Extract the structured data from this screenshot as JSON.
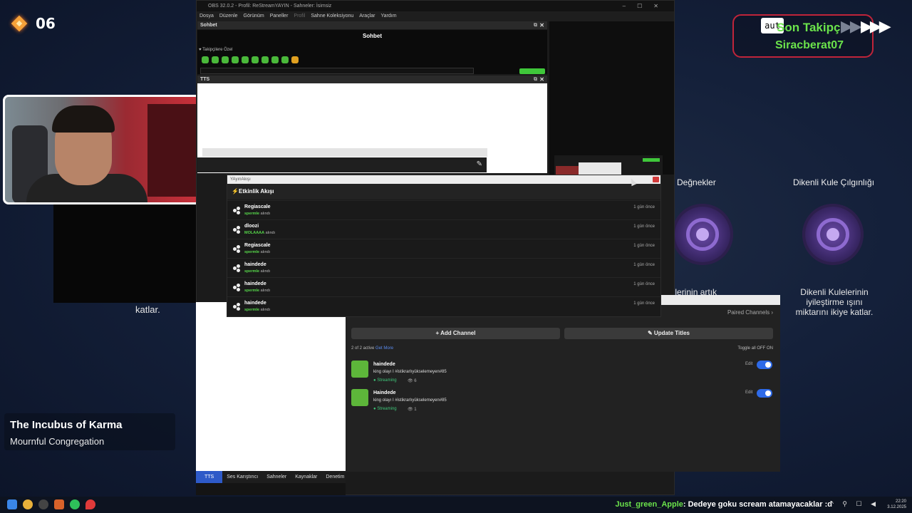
{
  "overlay": {
    "level": "06",
    "follower": {
      "logo": "aut",
      "title": "Son Takipçi",
      "name": "Siracberat07"
    },
    "cards": [
      {
        "title": "am Değnekler",
        "text": "ücülerinin artık"
      },
      {
        "title": "Dikenli Kule Çılgınlığı",
        "text": "Dikenli Kulelerinin iyileştirme ışını miktarını ikiye katlar."
      }
    ],
    "left_card_fragment": "katlar.",
    "song": {
      "title": "The Incubus of Karma",
      "artist": "Mournful Congregation"
    }
  },
  "obs": {
    "title": "OBS 32.0.2 - Profil: ReStreamYAYIN - Sahneler: İsimsiz",
    "menu": [
      "Dosya",
      "Düzenle",
      "Görünüm",
      "Paneller",
      "Profil",
      "Sahne Koleksiyonu",
      "Araçlar",
      "Yardım"
    ],
    "chat_dock": {
      "label": "Sohbet",
      "header": "Sohbet",
      "followers_only": "♥ Takipçilere Özel"
    },
    "tts_dock": {
      "label": "TTS"
    },
    "tabs": [
      "TTS",
      "Ses Karıştırıcı",
      "Sahneler",
      "Kaynaklar",
      "Denetim"
    ]
  },
  "feed": {
    "window_title": "YAyınAkışı",
    "header": "Etkinlik Akışı",
    "events": [
      {
        "user": "Regiascale",
        "item": "spermle",
        "action": "alındı",
        "time": "1 gün önce"
      },
      {
        "user": "dloozi",
        "item": "MOLAAAA",
        "action": "alındı",
        "time": "1 gün önce"
      },
      {
        "user": "Regiascale",
        "item": "spermle",
        "action": "alındı",
        "time": "1 gün önce"
      },
      {
        "user": "haindede",
        "item": "spermle",
        "action": "alındı",
        "time": "1 gün önce"
      },
      {
        "user": "haindede",
        "item": "spermle",
        "action": "alındı",
        "time": "1 gün önce"
      },
      {
        "user": "haindede",
        "item": "spermle",
        "action": "alındı",
        "time": "1 gün önce"
      }
    ]
  },
  "channels": {
    "paired": "Paired Channels ›",
    "add_channel": "+ Add Channel",
    "update_titles": "✎ Update Titles",
    "active_count": "2 of 2 active",
    "get_more": "Get More",
    "toggle_all": "Toggle all   OFF   ON",
    "items": [
      {
        "name": "haindede",
        "desc": "king olayı I #istikrarlıyükselemeyen#85",
        "status": "● Streaming",
        "viewers": "👁 6",
        "edit": "Edit"
      },
      {
        "name": "Haindede",
        "desc": "king olayı I #istikrarlıyükselemeyen#85",
        "status": "● Streaming",
        "viewers": "👁 1",
        "edit": "Edit"
      }
    ]
  },
  "taskbar": {
    "chat_user": "Just_green_Apple",
    "chat_message": ": Dedeye goku scream atamayacaklar :d",
    "tray": "^ ⚲ ☐ ◀",
    "time": "22:20",
    "date": "3.12.2025"
  },
  "colors": {
    "accent_green": "#6be34b",
    "alert_border": "#c0243a",
    "toggle_blue": "#2e6ae8",
    "tab_active": "#2e5ac8"
  }
}
